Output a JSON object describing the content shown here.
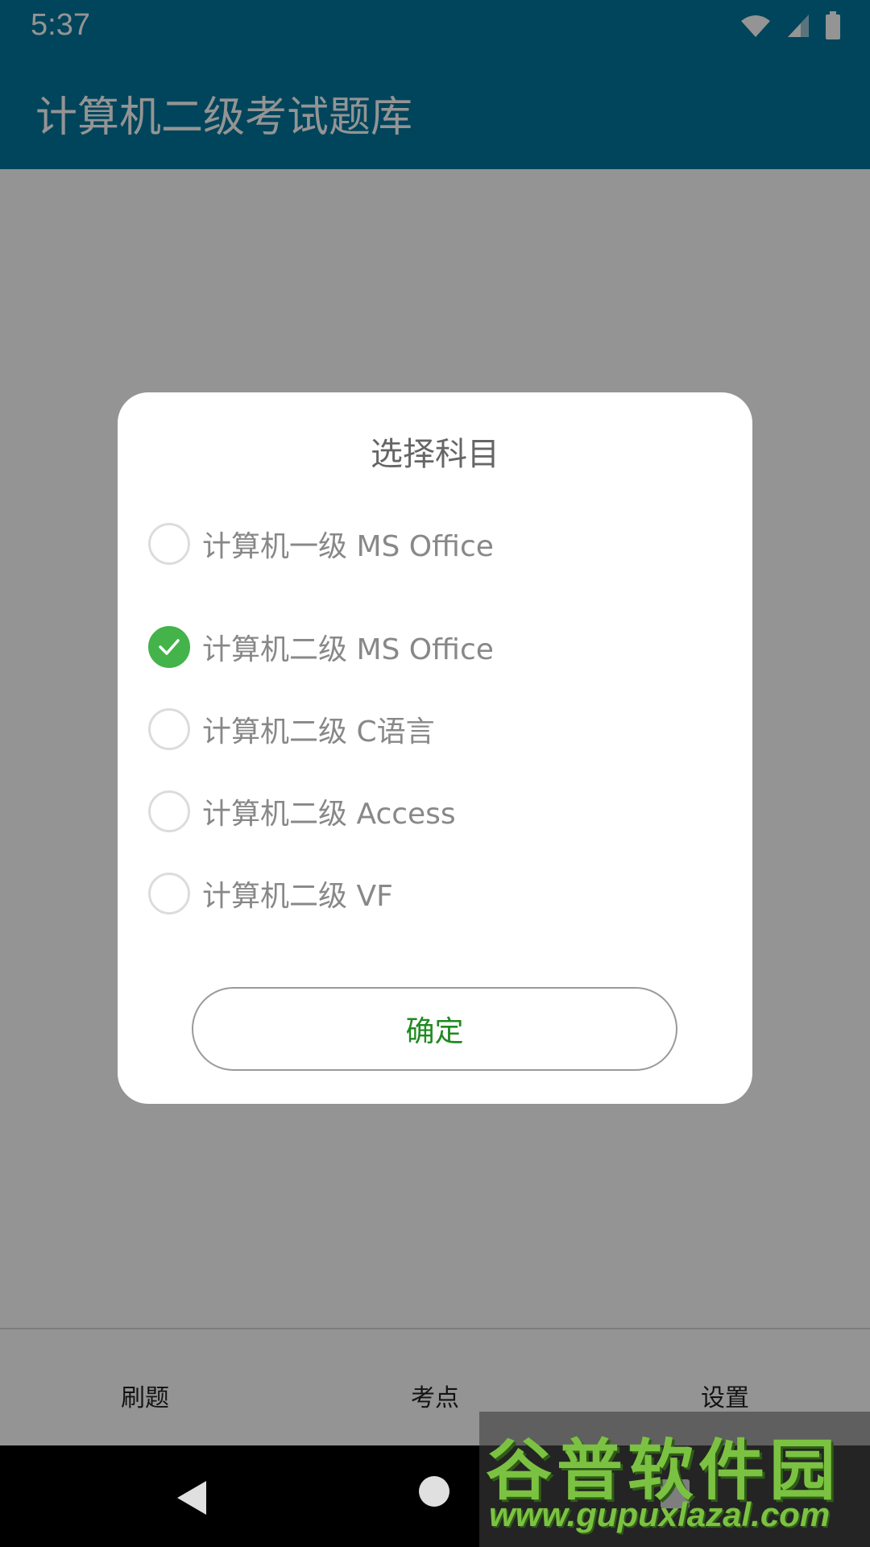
{
  "status_bar": {
    "time": "5:37",
    "icons": [
      "wifi-icon",
      "signal-icon",
      "battery-icon"
    ]
  },
  "app_bar": {
    "title": "计算机二级考试题库"
  },
  "dialog": {
    "title": "选择科目",
    "options": [
      {
        "label": "计算机一级 MS Office",
        "checked": false
      },
      {
        "label": "计算机二级 MS Office",
        "checked": true
      },
      {
        "label": "计算机二级 C语言",
        "checked": false
      },
      {
        "label": "计算机二级 Access",
        "checked": false
      },
      {
        "label": "计算机二级 VF",
        "checked": false
      }
    ],
    "confirm_label": "确定"
  },
  "bottom_nav": {
    "tabs": [
      {
        "label": "刷题"
      },
      {
        "label": "考点"
      },
      {
        "label": "设置"
      }
    ]
  },
  "system_nav": {
    "icons": [
      "back-icon",
      "home-icon",
      "recents-icon"
    ]
  },
  "watermark": {
    "text": "谷普软件园",
    "url": "www.gupuxlazal.com"
  },
  "colors": {
    "app_bar": "#00779e",
    "check_green": "#43b34a",
    "confirm_text": "#1f8a1f"
  }
}
